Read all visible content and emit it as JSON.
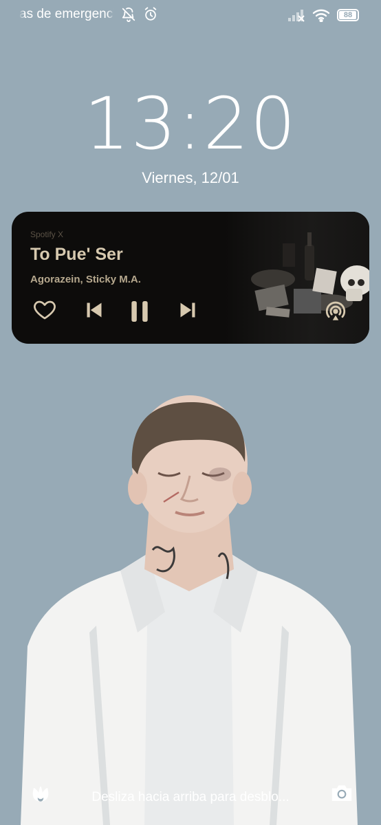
{
  "status_bar": {
    "ticker_text": "as de emergencia",
    "battery_level": "88",
    "icons": [
      "bell-off-icon",
      "alarm-icon",
      "cellular-signal-icon",
      "wifi-icon",
      "battery-icon"
    ]
  },
  "lock_screen": {
    "time": "13:20",
    "date": "Viernes, 12/01",
    "unlock_hint": "Desliza hacia arriba para desblo..."
  },
  "media_card": {
    "source": "Spotify X",
    "title": "To Pue' Ser",
    "artist": "Agorazein, Sticky M.A.",
    "controls": [
      "heart-icon",
      "previous-icon",
      "pause-icon",
      "next-icon",
      "audio-output-icon"
    ],
    "colors": {
      "background": "#0d0c0b",
      "accent": "#d7c9af"
    }
  },
  "colors": {
    "wallpaper": "#97aab6",
    "text": "#ffffff"
  }
}
